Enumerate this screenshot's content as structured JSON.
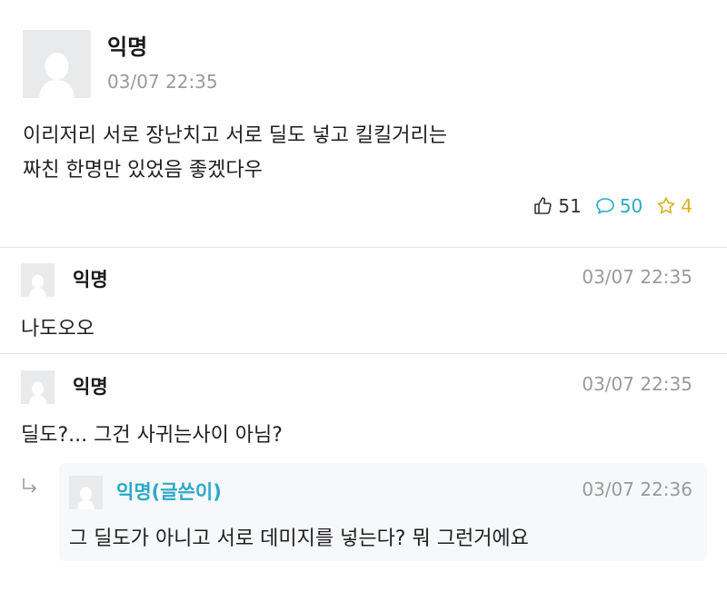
{
  "post": {
    "author": "익명",
    "time": "03/07 22:35",
    "body_lines": [
      "이리저리 서로 장난치고 서로 딜도 넣고 킬킬거리는",
      "짜친 한명만 있었음 좋겠다우"
    ],
    "likes": "51",
    "comments": "50",
    "scraps": "4"
  },
  "comments": [
    {
      "author": "익명",
      "time": "03/07 22:35",
      "text": "나도오오"
    },
    {
      "author": "익명",
      "time": "03/07 22:35",
      "text": "딜도?... 그건 사귀는사이 아님?"
    }
  ],
  "reply": {
    "author": "익명(글쓴이)",
    "time": "03/07 22:36",
    "text": "그 딜도가 아니고 서로 데미지를 넣는다? 뭐 그런거에요"
  },
  "colors": {
    "author_highlight": "#2aa9c9",
    "like": "#333333",
    "comment": "#2aa9c9",
    "scrap": "#d8b11a"
  },
  "icons": {
    "like": "thumbs-up-icon",
    "comment": "speech-bubble-icon",
    "scrap": "star-icon",
    "avatar": "default-avatar-icon",
    "reply": "reply-arrow-icon"
  }
}
